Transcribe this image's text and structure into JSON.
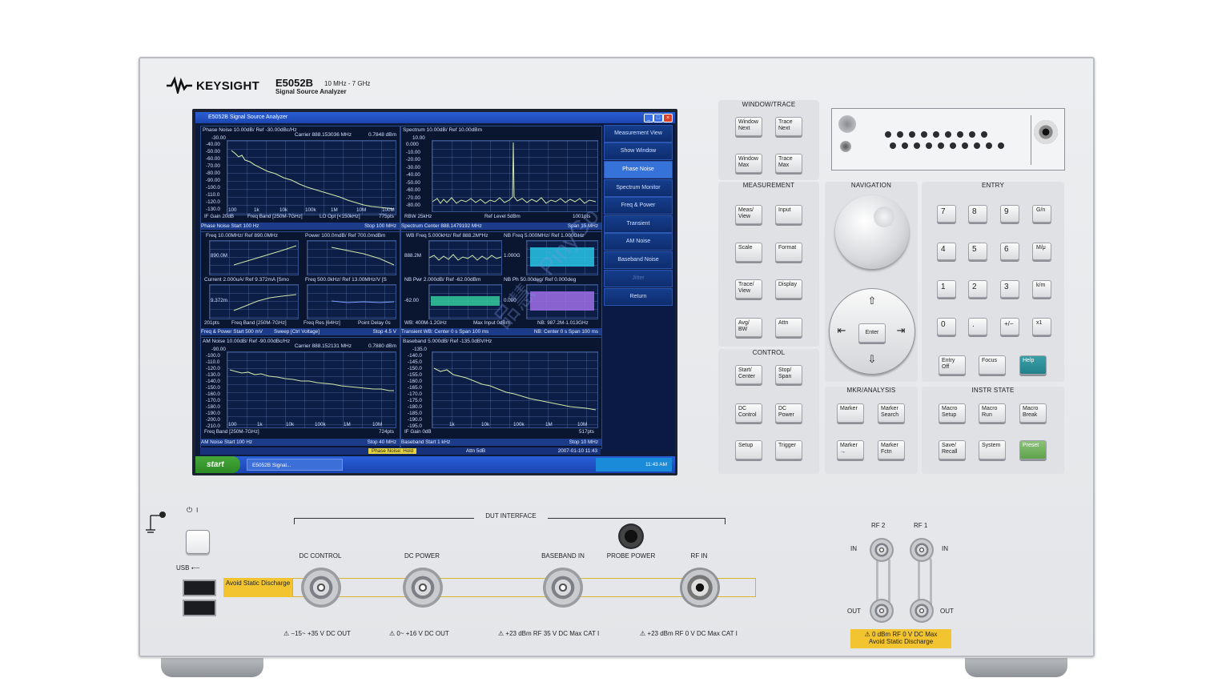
{
  "brand": {
    "name": "KEYSIGHT",
    "model": "E5052B",
    "freq_range": "10 MHz - 7 GHz",
    "subtitle": "Signal Source Analyzer"
  },
  "screen": {
    "window_title": "E5052B Signal Source Analyzer",
    "phase_noise": {
      "header": "Phase Noise 10.00dB/ Ref -30.00dBc/Hz",
      "carrier": "Carrier 888.153036 MHz",
      "level": "0.7848 dBm",
      "top": "-30.00",
      "yticks": [
        "-40.00",
        "-50.00",
        "-60.00",
        "-70.00",
        "-80.00",
        "-90.00",
        "-100.0",
        "-110.0",
        "-120.0",
        "-130.0"
      ],
      "xticks": [
        "100",
        "1k",
        "10k",
        "100k",
        "1M",
        "10M",
        "100M"
      ],
      "footer1": "IF Gain 20dB",
      "footer2": "Freq Band [250M-7GHz]",
      "footer3": "LO Opt [<150kHz]",
      "footer4": "775pts",
      "status": "Phase Noise  Start 100 Hz",
      "status_stop": "Stop 100 MHz"
    },
    "spectrum": {
      "header": "Spectrum 10.00dB/ Ref 10.00dBm",
      "top": "10.00",
      "yticks": [
        "0.000",
        "-10.00",
        "-20.00",
        "-30.00",
        "-40.00",
        "-50.00",
        "-60.00",
        "-70.00",
        "-80.00"
      ],
      "footer1": "RBW 25kHz",
      "footer2": "Ref Level 5dBm",
      "footer3": "1001pts",
      "status": "Spectrum  Center 888.1479192 MHz",
      "status_stop": "Span 15 MHz"
    },
    "freq_power": {
      "h1": "Freq 10.00MHz/ Ref 890.0MHz",
      "h2": "Power 100.0mdB/ Ref 700.0mdBm",
      "h3": "Current 2.000uA/ Ref 9.372mA [Smo",
      "h4": "Freq 500.0kHz/ Ref 13.00MHz/V [S",
      "v1": "890.0M",
      "v2": "9.372m",
      "footer1": "201pts",
      "footer2": "Freq Band [250M-7GHz]",
      "footer3": "Freq Res [64Hz]",
      "footer4": "Point Delay 0s",
      "status": "Freq & Power  Start 500 mV",
      "status_mid": "Sweep [Ctrl Voltage]",
      "status_stop": "Stop 4.5 V"
    },
    "transient": {
      "h1": "WB Freq 5.000kHz/ Ref 888.2M*Hz",
      "h2": "NB Freq 5.000MHz/ Ref 1.000GHz",
      "h3": "NB Pwr 2.000dB/ Ref -62.00dBm",
      "h4": "NB Ph 50.00deg/ Ref 0.000deg",
      "v1": "888.2M",
      "v2": "1.000G",
      "v3": "-62.00",
      "v4": "0.000",
      "footer1": "WB: 400M-1.2GHz",
      "footer2": "Max Input 0dBm",
      "footer3": "NB: 987.2M-1.013GHz",
      "status": "Transient  WB: Center 0 s  Span 100 ms",
      "status_stop": "NB: Center 0 s  Span 100 ms"
    },
    "am_noise": {
      "header": "AM Noise 10.00dB/ Ref -90.00dBc/Hz",
      "carrier": "Carrier 888.152131 MHz",
      "level": "0.7880 dBm",
      "top": "-90.00",
      "yticks": [
        "-100.0",
        "-110.0",
        "-120.0",
        "-130.0",
        "-140.0",
        "-150.0",
        "-160.0",
        "-170.0",
        "-180.0",
        "-190.0",
        "-200.0",
        "-210.0"
      ],
      "xticks": [
        "100",
        "1k",
        "10k",
        "100k",
        "1M",
        "10M"
      ],
      "footer1": "Freq Band [250M-7GHz]",
      "footer2": "724pts",
      "status": "AM Noise  Start 100 Hz",
      "status_stop": "Stop 40 MHz"
    },
    "baseband": {
      "header": "Baseband 5.000dB/ Ref -135.0dBV/Hz",
      "top": "-135.0",
      "yticks": [
        "-140.0",
        "-145.0",
        "-150.0",
        "-155.0",
        "-160.0",
        "-165.0",
        "-170.0",
        "-175.0",
        "-180.0",
        "-185.0",
        "-190.0",
        "-195.0"
      ],
      "xticks": [
        "1k",
        "10k",
        "100k",
        "1M",
        "10M"
      ],
      "footer1": "IF Gain 0dB",
      "footer2": "517pts",
      "status": "Baseband  Start 1 kHz",
      "status_stop": "Stop 10 MHz"
    },
    "bottom_status": {
      "mode": "Phase Noise: Hold",
      "attn": "Attn 5dB",
      "datetime": "2007-01-10 11:43"
    },
    "softkeys": [
      "Measurement View",
      "Show Window",
      "Phase Noise",
      "Spectrum Monitor",
      "Freq & Power",
      "Transient",
      "AM Noise",
      "Baseband Noise",
      "Jitter",
      "Return"
    ],
    "taskbar": {
      "start": "start",
      "task": "E5052B Signal...",
      "clock": "11:43 AM"
    }
  },
  "keypad": {
    "window_trace": {
      "label": "WINDOW/TRACE",
      "keys": [
        "Window Next",
        "Trace Next",
        "Window Max",
        "Trace Max"
      ]
    },
    "measurement": {
      "label": "MEASUREMENT",
      "keys": [
        "Meas/ View",
        "Input",
        "Scale",
        "Format",
        "Trace/ View",
        "Display",
        "Avg/ BW",
        "Attn"
      ]
    },
    "control": {
      "label": "CONTROL",
      "keys": [
        "Start/ Center",
        "Stop/ Span",
        "DC Control",
        "DC Power",
        "Setup",
        "Trigger"
      ]
    },
    "navigation": {
      "label": "NAVIGATION",
      "enter": "Enter"
    },
    "entry": {
      "label": "ENTRY",
      "keys": [
        "7",
        "8",
        "9",
        "G/n",
        "4",
        "5",
        "6",
        "M/μ",
        "1",
        "2",
        "3",
        "k/m",
        "0",
        ".",
        "+/−",
        "x1"
      ],
      "extra": [
        "Entry Off",
        "Focus",
        "Help"
      ]
    },
    "mkr_analysis": {
      "label": "MKR/ANALYSIS",
      "keys": [
        "Marker",
        "Marker Search",
        "Marker →",
        "Marker Fctn"
      ]
    },
    "instr_state": {
      "label": "INSTR STATE",
      "keys": [
        "Macro Setup",
        "Macro Run",
        "Macro Break",
        "Save/ Recall",
        "System",
        "Preset"
      ]
    }
  },
  "front_panel": {
    "dut_interface": "DUT INTERFACE",
    "usb": "USB",
    "avoid_static": "Avoid Static Discharge",
    "ports": [
      {
        "label": "DC CONTROL",
        "spec": "⚠ −15~ +35 V DC OUT"
      },
      {
        "label": "DC POWER",
        "spec": "⚠ 0~ +16 V DC OUT"
      },
      {
        "label": "BASEBAND IN",
        "spec": "⚠ +23 dBm RF  35 V DC  Max  CAT I"
      },
      {
        "label": "RF IN",
        "spec": "⚠ +23 dBm RF  0 V DC  Max  CAT I"
      }
    ],
    "probe_power": "PROBE POWER",
    "rf2": "RF 2",
    "rf1": "RF 1",
    "in": "IN",
    "out": "OUT",
    "rf_warning_1": "⚠ 0 dBm RF  0 V DC  Max",
    "rf_warning_2": "Avoid Static Discharge"
  },
  "watermark": "品慧 · PinyGo"
}
